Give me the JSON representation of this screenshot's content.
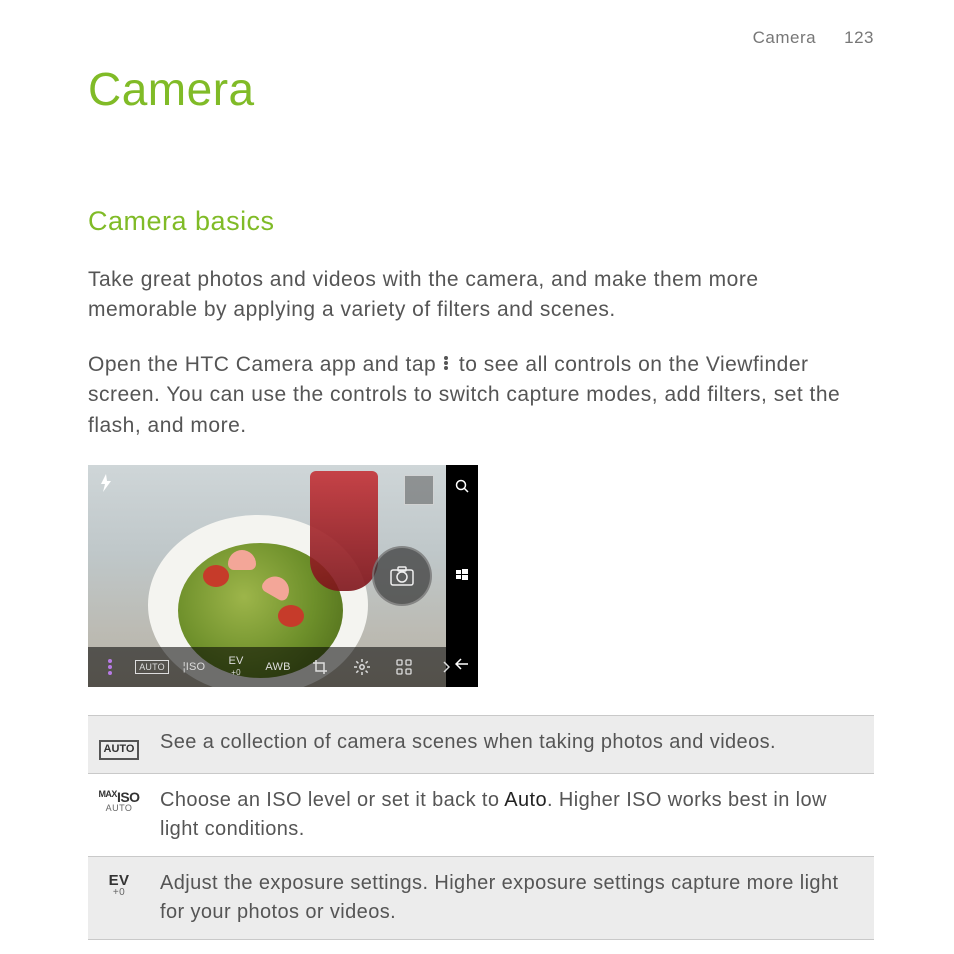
{
  "header": {
    "section": "Camera",
    "page": "123"
  },
  "title": "Camera",
  "subtitle": "Camera basics",
  "para1": "Take great photos and videos with the camera, and make them more memorable by applying a variety of filters and scenes.",
  "para2a": "Open the HTC Camera app and tap ",
  "para2b": " to see all controls on the Viewfinder screen. You can use the controls to switch capture modes, add filters, set the flash, and more.",
  "screenshot": {
    "controls": {
      "auto": "AUTO",
      "iso": "ISO",
      "ev": "EV",
      "ev_sub": "+0",
      "awb": "AWB"
    }
  },
  "table": [
    {
      "icon": "auto",
      "icon_label": "AUTO",
      "text": "See a collection of camera scenes when taking photos and videos."
    },
    {
      "icon": "iso",
      "icon_top": "ISO",
      "icon_bot": "AUTO",
      "text_a": "Choose an ISO level or set it back to ",
      "text_bold": "Auto",
      "text_b": ". Higher ISO works best in low light conditions."
    },
    {
      "icon": "ev",
      "icon_top": "EV",
      "icon_bot": "+0",
      "text": "Adjust the exposure settings. Higher exposure settings capture more light for your photos or videos."
    }
  ]
}
